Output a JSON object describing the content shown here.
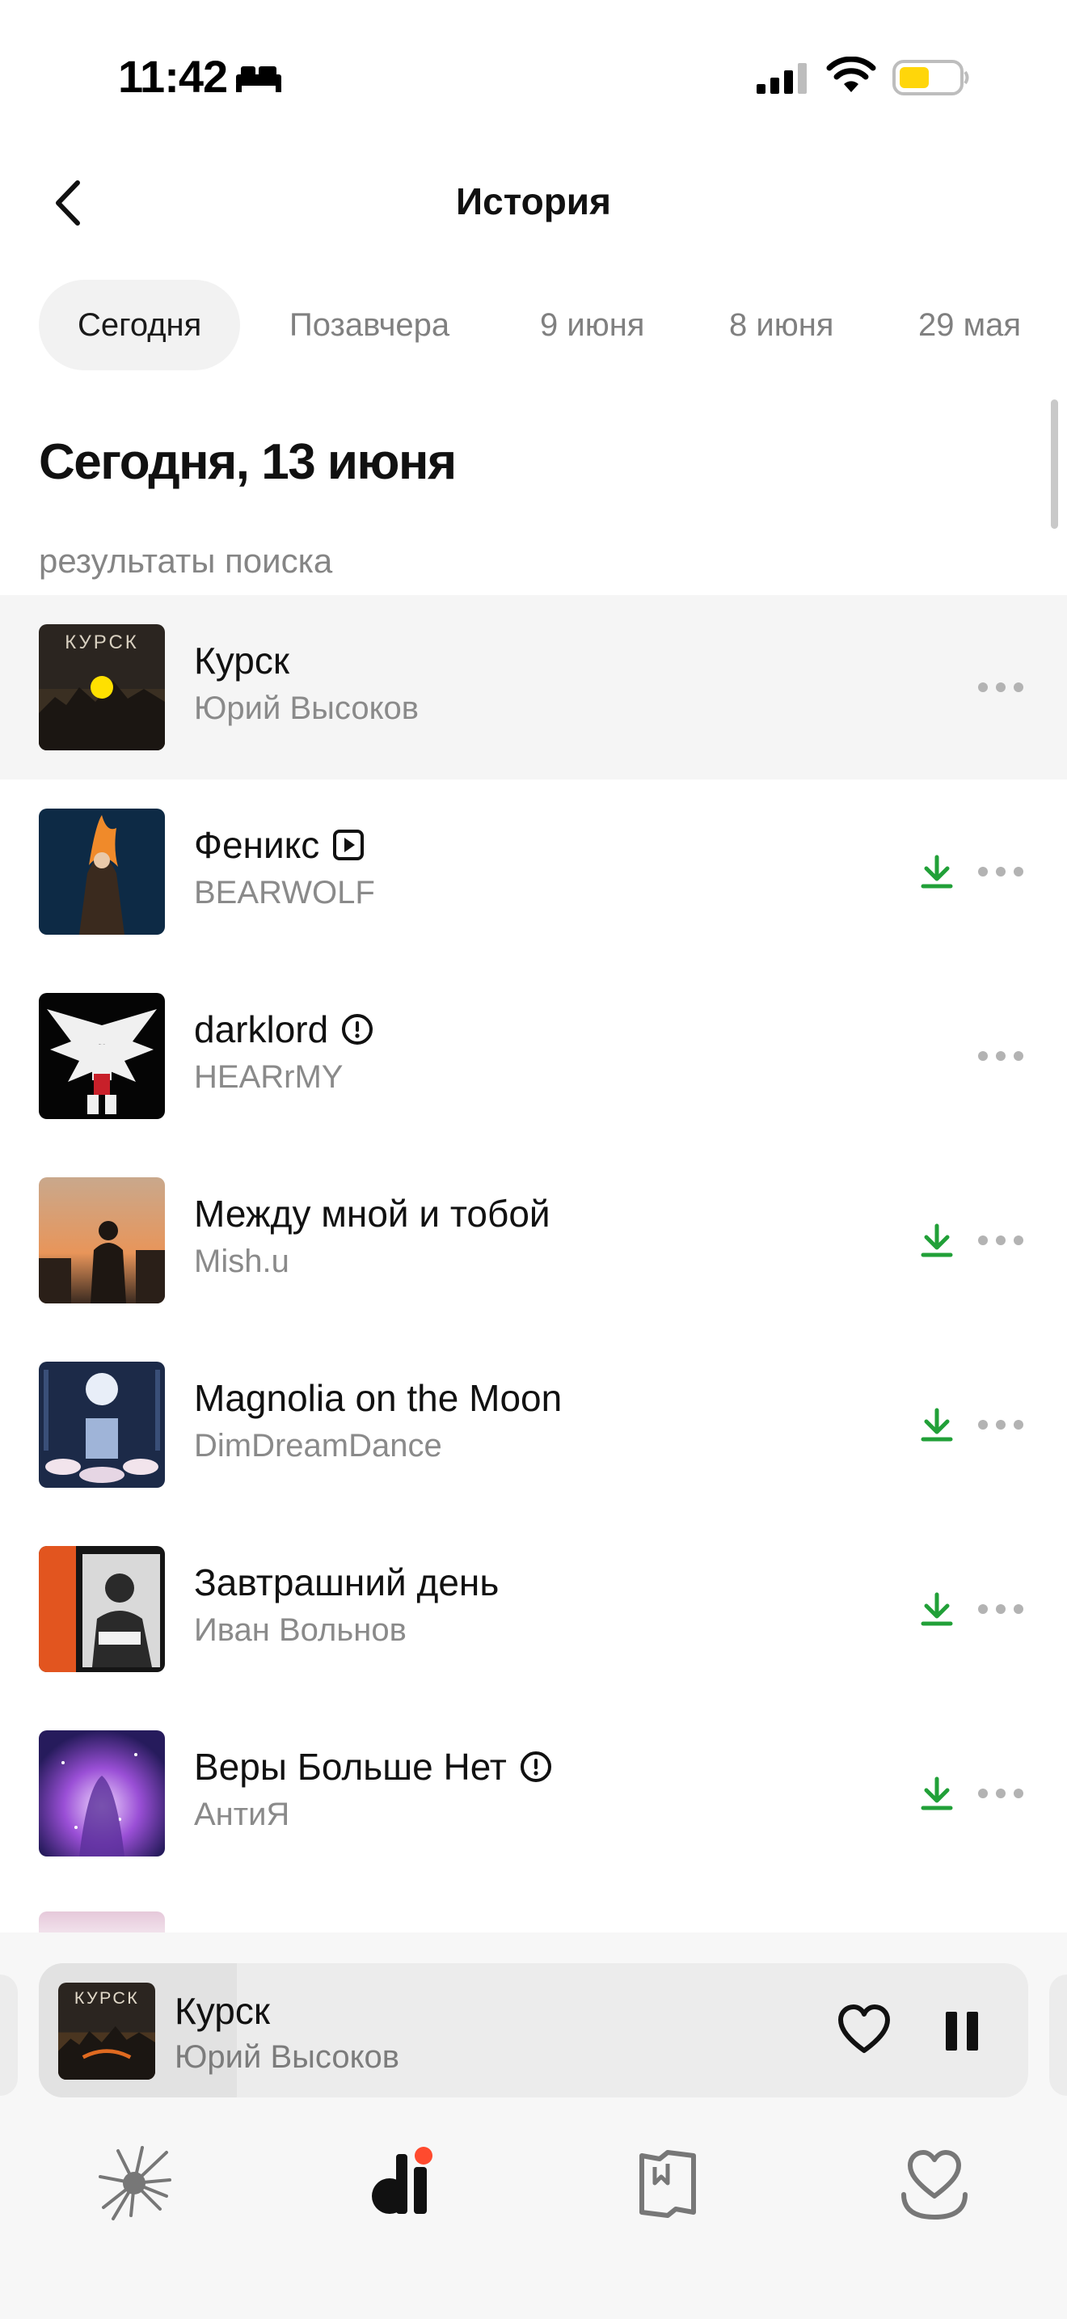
{
  "status_bar": {
    "time": "11:42"
  },
  "header": {
    "title": "История"
  },
  "tabs": [
    {
      "label": "Сегодня",
      "active": true
    },
    {
      "label": "Позавчера",
      "active": false
    },
    {
      "label": "9 июня",
      "active": false
    },
    {
      "label": "8 июня",
      "active": false
    },
    {
      "label": "29 мая",
      "active": false
    }
  ],
  "section": {
    "title": "Сегодня, 13 июня",
    "subtitle": "результаты поиска"
  },
  "tracks": [
    {
      "title": "Курск",
      "artist": "Юрий Высоков",
      "badge": "",
      "downloaded": false,
      "playing": true
    },
    {
      "title": "Феникс",
      "artist": "BEARWOLF",
      "badge": "video-clip-icon",
      "downloaded": true,
      "playing": false
    },
    {
      "title": "darklord",
      "artist": "HEARrMY",
      "badge": "explicit-icon",
      "downloaded": false,
      "playing": false
    },
    {
      "title": "Между мной и тобой",
      "artist": "Mish.u",
      "badge": "",
      "downloaded": true,
      "playing": false
    },
    {
      "title": "Magnolia on the Moon",
      "artist": "DimDreamDance",
      "badge": "",
      "downloaded": true,
      "playing": false
    },
    {
      "title": "Завтрашний день",
      "artist": "Иван Вольнов",
      "badge": "",
      "downloaded": true,
      "playing": false
    },
    {
      "title": "Веры Больше Нет",
      "artist": "АнтиЯ",
      "badge": "explicit-icon",
      "downloaded": true,
      "playing": false
    }
  ],
  "mini_player": {
    "title": "Курск",
    "artist": "Юрий Высоков",
    "progress": 0.2
  },
  "bottom_nav": [
    {
      "icon": "vibe-star-icon"
    },
    {
      "icon": "collection-icon",
      "notification": true
    },
    {
      "icon": "book-icon"
    },
    {
      "icon": "heart-podcast-icon"
    }
  ],
  "colors": {
    "accent_green": "#21a038",
    "playing_dot": "#ffe000",
    "battery": "#ffd60a",
    "notification_dot": "#ff4a2e"
  }
}
